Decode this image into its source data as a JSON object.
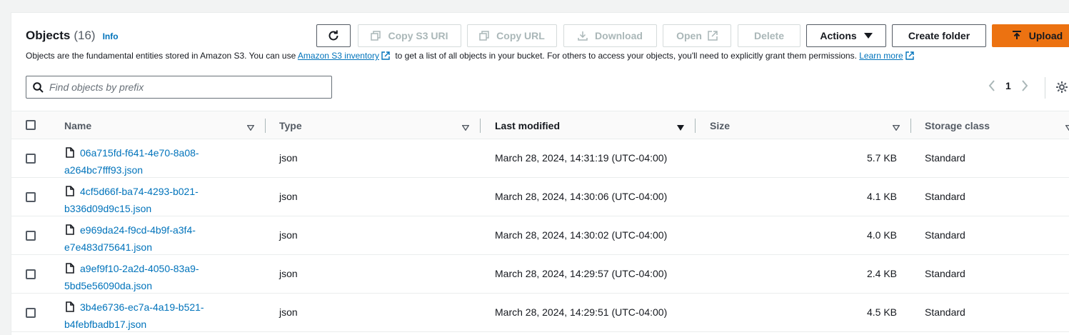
{
  "header": {
    "title": "Objects",
    "count": "(16)",
    "info": "Info",
    "description_pre": "Objects are the fundamental entities stored in Amazon S3. You can use ",
    "inventory_link": "Amazon S3 inventory",
    "description_mid": " to get a list of all objects in your bucket. For others to access your objects, you'll need to explicitly grant them permissions. ",
    "learn_more": "Learn more"
  },
  "toolbar": {
    "copy_s3_uri": "Copy S3 URI",
    "copy_url": "Copy URL",
    "download": "Download",
    "open": "Open",
    "delete": "Delete",
    "actions": "Actions",
    "create_folder": "Create folder",
    "upload": "Upload"
  },
  "search": {
    "placeholder": "Find objects by prefix",
    "value": ""
  },
  "pagination": {
    "current_page": "1"
  },
  "table": {
    "columns": [
      "Name",
      "Type",
      "Last modified",
      "Size",
      "Storage class"
    ],
    "rows": [
      {
        "name_line1": "06a715fd-f641-4e70-8a08-",
        "name_line2": "a264bc7fff93.json",
        "type": "json",
        "last_modified": "March 28, 2024, 14:31:19 (UTC-04:00)",
        "size": "5.7 KB",
        "storage_class": "Standard"
      },
      {
        "name_line1": "4cf5d66f-ba74-4293-b021-",
        "name_line2": "b336d09d9c15.json",
        "type": "json",
        "last_modified": "March 28, 2024, 14:30:06 (UTC-04:00)",
        "size": "4.1 KB",
        "storage_class": "Standard"
      },
      {
        "name_line1": "e969da24-f9cd-4b9f-a3f4-",
        "name_line2": "e7e483d75641.json",
        "type": "json",
        "last_modified": "March 28, 2024, 14:30:02 (UTC-04:00)",
        "size": "4.0 KB",
        "storage_class": "Standard"
      },
      {
        "name_line1": "a9ef9f10-2a2d-4050-83a9-",
        "name_line2": "5bd5e56090da.json",
        "type": "json",
        "last_modified": "March 28, 2024, 14:29:57 (UTC-04:00)",
        "size": "2.4 KB",
        "storage_class": "Standard"
      },
      {
        "name_line1": "3b4e6736-ec7a-4a19-b521-",
        "name_line2": "b4febfbadb17.json",
        "type": "json",
        "last_modified": "March 28, 2024, 14:29:51 (UTC-04:00)",
        "size": "4.5 KB",
        "storage_class": "Standard"
      }
    ]
  },
  "colors": {
    "link": "#0073bb",
    "primary": "#ec7211",
    "text": "#16191f",
    "muted": "#545b64"
  }
}
